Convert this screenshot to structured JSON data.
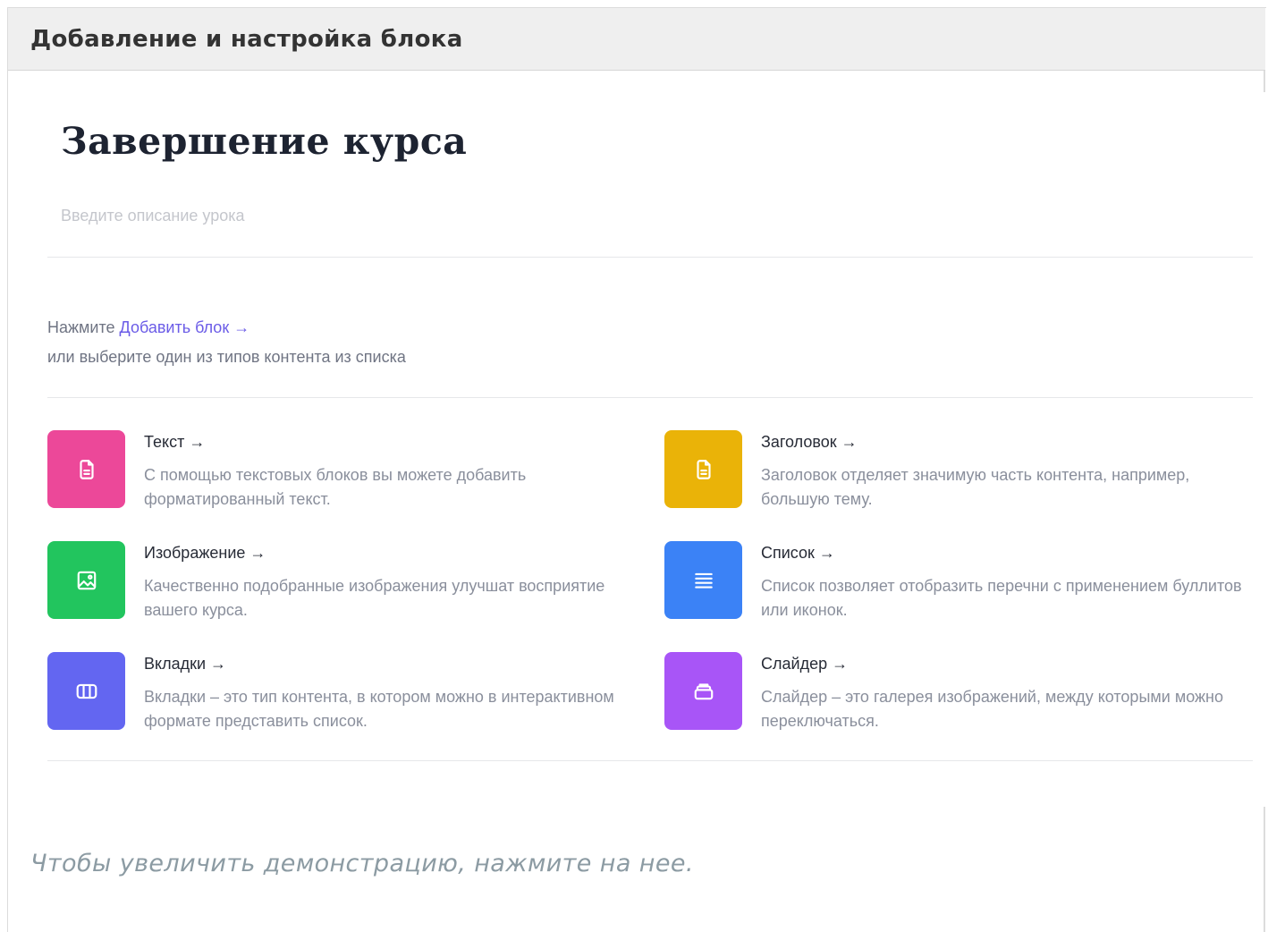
{
  "header": {
    "title": "Добавление и настройка блока"
  },
  "lesson": {
    "title": "Завершение курса",
    "description_placeholder": "Введите описание урока"
  },
  "hint": {
    "prefix": "Нажмите ",
    "link": "Добавить блок →",
    "line2": "или выберите один из типов контента из списка"
  },
  "blocks": [
    {
      "title": "Текст →",
      "description": "С помощью текстовых блоков вы можете добавить форматированный текст.",
      "color": "#ec4899",
      "icon": "document-icon"
    },
    {
      "title": "Заголовок →",
      "description": "Заголовок отделяет значимую часть контента, например, большую тему.",
      "color": "#eab308",
      "icon": "document-icon"
    },
    {
      "title": "Изображение →",
      "description": "Качественно подобранные изображения улучшат восприятие вашего курса.",
      "color": "#22c55e",
      "icon": "image-icon"
    },
    {
      "title": "Список →",
      "description": "Список позволяет отобразить перечни с применением буллитов или иконок.",
      "color": "#3b82f6",
      "icon": "list-icon"
    },
    {
      "title": "Вкладки →",
      "description": "Вкладки – это тип контента, в котором можно в интерактивном формате представить список.",
      "color": "#6366f1",
      "icon": "columns-icon"
    },
    {
      "title": "Слайдер →",
      "description": "Слайдер – это галерея изображений, между которыми можно переключаться.",
      "color": "#a855f7",
      "icon": "stack-icon"
    }
  ],
  "caption": "Чтобы увеличить демонстрацию, нажмите на нее."
}
